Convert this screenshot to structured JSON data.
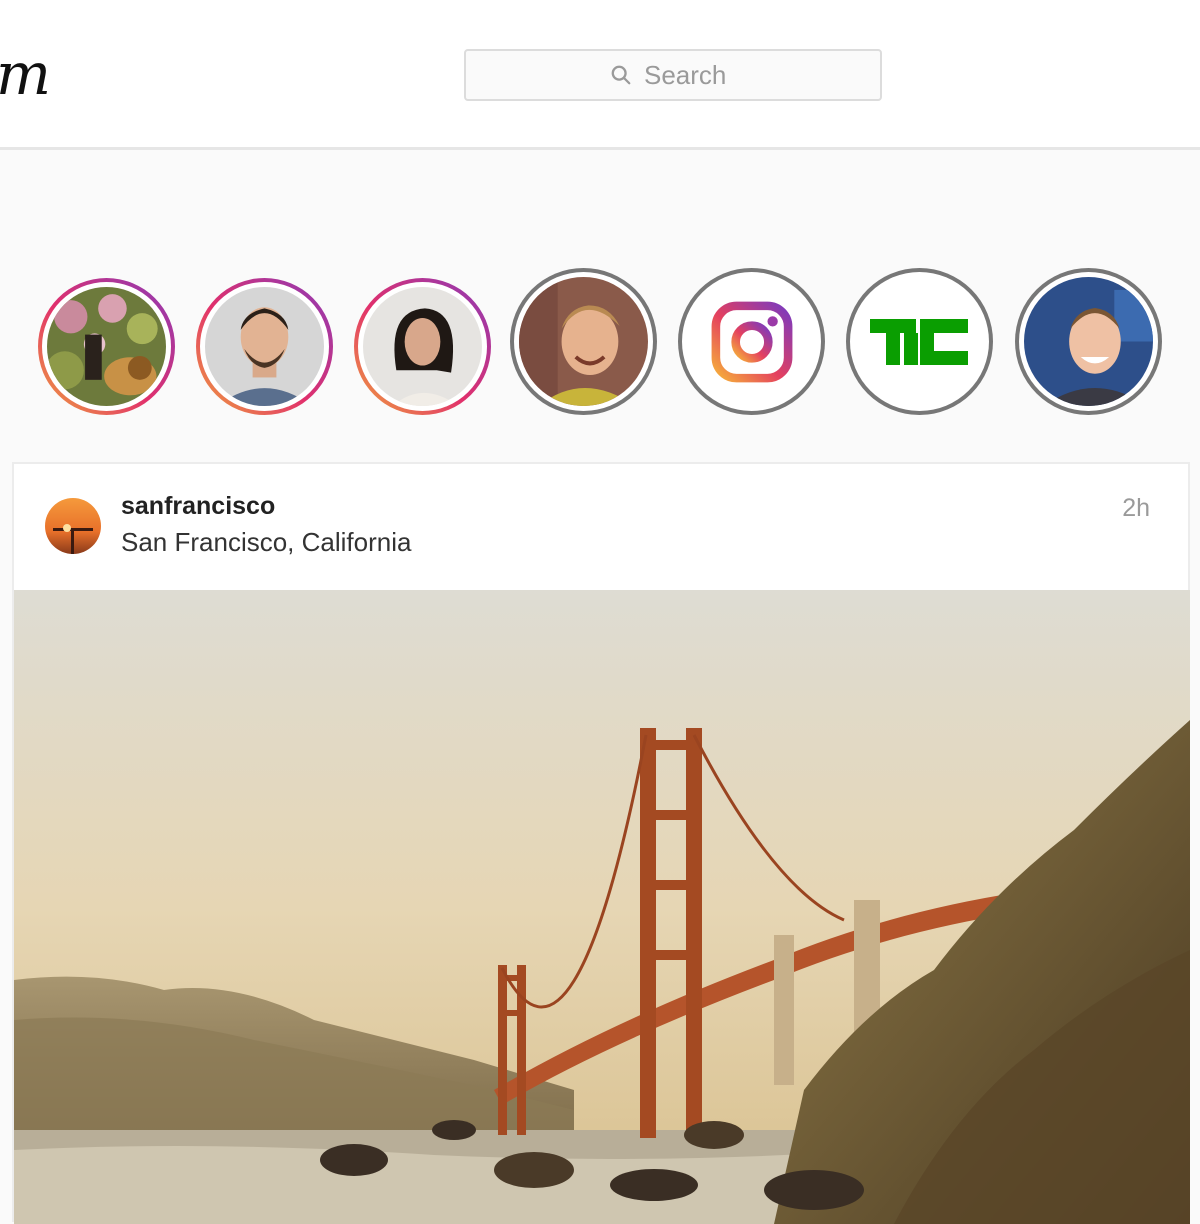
{
  "header": {
    "logo_text": "m",
    "search": {
      "placeholder": "Search"
    }
  },
  "stories": [
    {
      "name": "story-lion-garden",
      "state": "unseen"
    },
    {
      "name": "story-man-beard",
      "state": "unseen"
    },
    {
      "name": "story-woman",
      "state": "unseen"
    },
    {
      "name": "story-young-man",
      "state": "seen"
    },
    {
      "name": "story-instagram",
      "state": "seen"
    },
    {
      "name": "story-techcrunch",
      "state": "seen",
      "logo_text": "TC"
    },
    {
      "name": "story-mark",
      "state": "seen"
    }
  ],
  "post": {
    "username": "sanfrancisco",
    "location": "San Francisco, California",
    "time": "2h"
  },
  "colors": {
    "story_gradient": [
      "#f0a43c",
      "#e1306c",
      "#8a3ab9"
    ],
    "techcrunch_green": "#0a9e01",
    "bridge": "#b5542b"
  }
}
